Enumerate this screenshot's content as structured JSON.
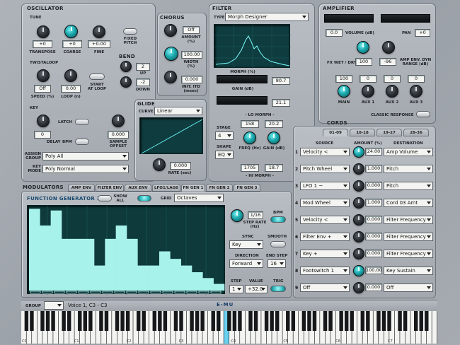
{
  "oscillator": {
    "title": "OSCILLATOR",
    "tune": "TUNE",
    "transpose": {
      "label": "TRANSPOSE",
      "value": "+0"
    },
    "coarse": {
      "label": "COARSE",
      "value": "+0"
    },
    "fine": {
      "label": "FINE",
      "value": "+0.00"
    },
    "fixed_pitch": "FIXED\nPITCH",
    "twistaloop": "TWISTALOOP",
    "speed": {
      "label": "SPEED (%)",
      "value": "Off"
    },
    "loop": {
      "label": "LOOP (n)",
      "value": "0.00"
    },
    "start_at_loop": "START\nAT LOOP",
    "key": "KEY",
    "latch": "LATCH",
    "delay": {
      "label": "DELAY",
      "value": "0"
    },
    "bpm": "BPM",
    "sample_offset": {
      "label": "SAMPLE\nOFFSET",
      "value": "0.000"
    },
    "assign_group": {
      "label": "ASSIGN\nGROUP",
      "value": "Poly All"
    },
    "key_mode": {
      "label": "KEY\nMODE",
      "value": "Poly Normal"
    }
  },
  "chorus": {
    "title": "CHORUS",
    "amount": {
      "label": "AMOUNT\n(%)",
      "value": "Off"
    },
    "width": {
      "label": "WIDTH\n(%)",
      "value": "100.00"
    },
    "init_itd": {
      "label": "INIT. ITD\n(msec)",
      "value": "0.000"
    }
  },
  "bend": {
    "title": "BEND",
    "up": {
      "label": "UP",
      "value": "2"
    },
    "down": {
      "label": "DOWN",
      "value": "-2"
    }
  },
  "glide": {
    "title": "GLIDE",
    "curve_label": "CURVE",
    "curve": "Linear",
    "rate": {
      "label": "RATE (sec)",
      "value": "0.000"
    }
  },
  "filter": {
    "title": "FILTER",
    "type_label": "TYPE",
    "type": "Morph Designer",
    "morph": {
      "label": "MORPH (%)",
      "value": "80.7"
    },
    "gain": {
      "label": "GAIN (dB)",
      "value": "21.1"
    },
    "lo_morph": "- LO MORPH -",
    "hi_morph": "- HI MORPH -",
    "stage": {
      "label": "STAGE",
      "value": "4"
    },
    "shape": {
      "label": "SHAPE",
      "value": "EQ"
    },
    "lo_freq": {
      "label": "FREQ (Hz)",
      "value": "158"
    },
    "lo_gain": {
      "label": "GAIN (dB)",
      "value": "20.2"
    },
    "hi_freq": "1705",
    "hi_gain": "18.7"
  },
  "amplifier": {
    "title": "AMPLIFIER",
    "volume": {
      "label": "VOLUME (dB)",
      "value": "0.0"
    },
    "pan": {
      "label": "PAN",
      "value": "+0"
    },
    "fx_wet_dry": {
      "label": "FX WET / DRY",
      "value": "100"
    },
    "amp_env_range": {
      "label": "AMP ENV. DYN\nRANGE (dB)",
      "value": "-96"
    },
    "outputs": [
      {
        "label": "MAIN",
        "value": "100"
      },
      {
        "label": "AUX 1",
        "value": "0"
      },
      {
        "label": "AUX 2",
        "value": "0"
      },
      {
        "label": "AUX 3",
        "value": "0"
      }
    ],
    "classic_response": "CLASSIC RESPONSE"
  },
  "cords": {
    "title": "CORDS",
    "tabs": [
      "01-09",
      "10-18",
      "19-27",
      "28-36"
    ],
    "headers": {
      "source": "SOURCE",
      "amount": "AMOUNT (%)",
      "destination": "DESTINATION"
    },
    "rows": [
      {
        "n": "1",
        "source": "Velocity  <",
        "amount": "24.00",
        "dest": "Amp Volume",
        "teal": true
      },
      {
        "n": "2",
        "source": "Pitch Wheel",
        "amount": "1.000",
        "dest": "Pitch",
        "teal": false
      },
      {
        "n": "3",
        "source": "LFO 1  ~",
        "amount": "0.000",
        "dest": "Pitch",
        "teal": false
      },
      {
        "n": "4",
        "source": "Mod Wheel",
        "amount": "1.000",
        "dest": "Cord 03 Amt",
        "teal": false
      },
      {
        "n": "5",
        "source": "Velocity  <",
        "amount": "0.000",
        "dest": "Filter Frequency",
        "teal": false
      },
      {
        "n": "6",
        "source": "Filter Env  +",
        "amount": "0.000",
        "dest": "Filter Frequency",
        "teal": false
      },
      {
        "n": "7",
        "source": "Key  +",
        "amount": "0.000",
        "dest": "Filter Frequency",
        "teal": false
      },
      {
        "n": "8",
        "source": "Footswitch 1",
        "amount": "100.00",
        "dest": "Key Sustain",
        "teal": true
      },
      {
        "n": "9",
        "source": "Off",
        "amount": "0.000",
        "dest": "Off",
        "teal": false
      }
    ]
  },
  "modulators": {
    "title": "MODULATORS",
    "tabs": [
      "AMP ENV",
      "FILTER ENV",
      "AUX ENV",
      "LFO1/LAG0",
      "FN GEN 1",
      "FN GEN 2",
      "FN GEN 3"
    ],
    "active_tab": 4,
    "fg_title": "FUNCTION GENERATOR 1",
    "show_all": "SHOW\nALL",
    "grid_label": "GRID",
    "grid": "Octaves",
    "step_rate": {
      "label": "STEP RATE\n(Hz)",
      "value": "1/16"
    },
    "bpm": "BPM",
    "sync": {
      "label": "SYNC",
      "value": "Key"
    },
    "smooth": "SMOOTH",
    "direction": {
      "label": "DIRECTION",
      "value": "Forward"
    },
    "end_step": {
      "label": "END STEP",
      "value": "16"
    },
    "step": {
      "label": "STEP",
      "value": "1"
    },
    "value": {
      "label": "VALUE",
      "value": "+32.0"
    },
    "trig": "TRIG",
    "fg_steps": [
      0.98,
      0.78,
      0.96,
      0.62,
      0.62,
      0.62,
      0.3,
      0.62,
      0.78,
      0.62,
      0.3,
      0.3,
      0.47,
      0.38,
      0.3,
      0.22,
      0.15,
      0.08
    ]
  },
  "footer": {
    "group": "GROUP",
    "voice": "Voice 1, C3 - C3",
    "logo": "E-MU"
  },
  "keyboard": {
    "octave_labels": [
      "C0",
      "C1",
      "C2",
      "C3",
      "C4",
      "C5",
      "C6",
      "C7"
    ]
  }
}
